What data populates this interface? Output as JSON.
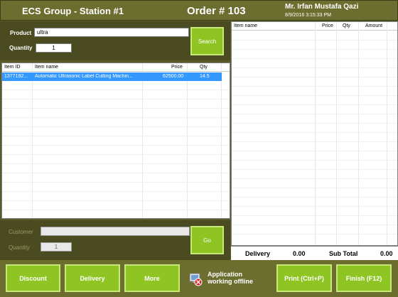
{
  "header": {
    "station": "ECS Group - Station #1",
    "order": "Order # 103",
    "user": "Mr. Irfan Mustafa Qazi",
    "datetime": "8/9/2016 3:15:33 PM"
  },
  "search": {
    "product_label": "Product",
    "product_value": "ultra",
    "quantity_label": "Quantity",
    "quantity_value": "1",
    "search_button": "Search"
  },
  "items_table": {
    "headers": [
      "Item ID",
      "Item name",
      "Price",
      "Qty"
    ],
    "rows": [
      {
        "id": "1377192...",
        "name": "Automatic Ultrasonic Label Cutting Machin...",
        "price": "62500.00",
        "qty": "14.5"
      }
    ]
  },
  "customer": {
    "customer_label": "Customer",
    "customer_value": "",
    "quantity_label": "Quantity",
    "quantity_value": "1",
    "go_button": "Go"
  },
  "order_table": {
    "headers": [
      "Item name",
      "Price",
      "Qty",
      "Amount"
    ]
  },
  "totals": {
    "delivery_label": "Delivery",
    "delivery_value": "0.00",
    "subtotal_label": "Sub Total",
    "subtotal_value": "0.00"
  },
  "footer": {
    "discount": "Discount",
    "delivery": "Delivery",
    "more": "More",
    "offline_line1": "Application",
    "offline_line2": "working offline",
    "print": "Print (Ctrl+P)",
    "finish": "Finish (F12)"
  },
  "colors": {
    "header_bg": "#6b6e2f",
    "panel_bg": "#4a4b20",
    "button_green": "#8fc523",
    "selection_blue": "#3399ff"
  },
  "icons": [
    "offline-warning-icon"
  ]
}
